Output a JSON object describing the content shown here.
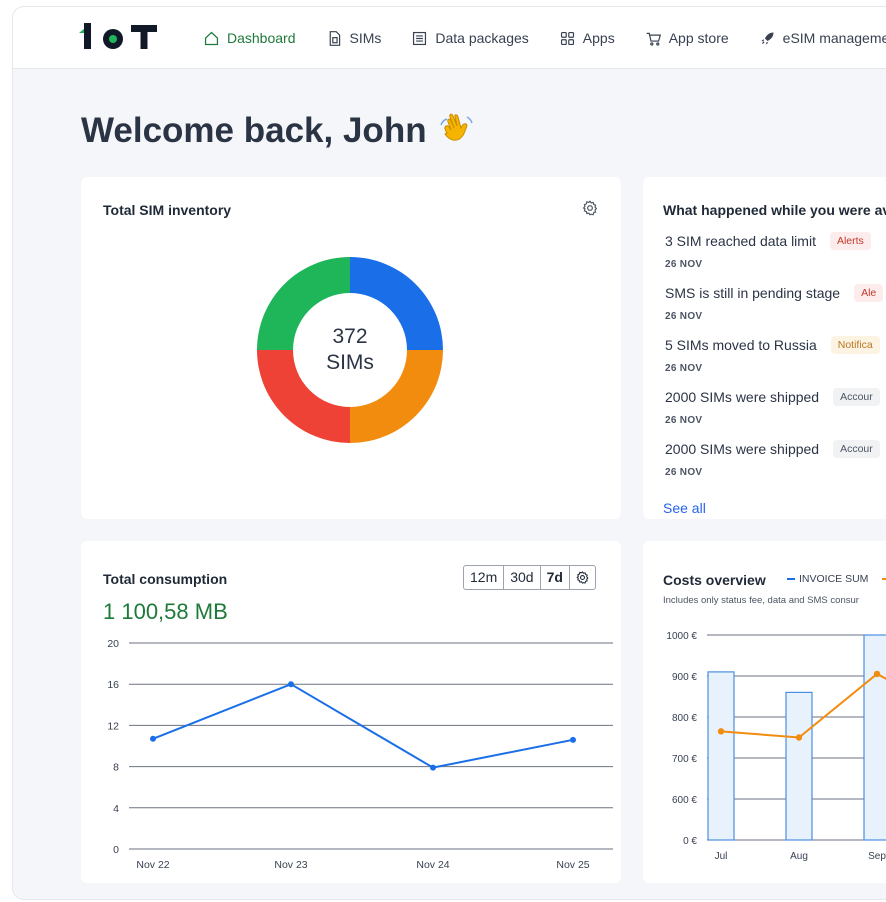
{
  "nav": {
    "items": [
      {
        "label": "Dashboard",
        "icon": "home-icon",
        "active": true
      },
      {
        "label": "SIMs",
        "icon": "sim-card-icon"
      },
      {
        "label": "Data packages",
        "icon": "package-icon"
      },
      {
        "label": "Apps",
        "icon": "apps-grid-icon"
      },
      {
        "label": "App store",
        "icon": "cart-icon"
      },
      {
        "label": "eSIM manageme",
        "icon": "rocket-icon"
      }
    ]
  },
  "welcome": {
    "title": "Welcome back, John"
  },
  "inventory": {
    "title": "Total SIM inventory",
    "count": "372",
    "unit": "SIMs",
    "colors": [
      "#1a6fe8",
      "#f28c0f",
      "#ee4237",
      "#1fb65a"
    ]
  },
  "events": {
    "title": "What happened while you were av",
    "items": [
      {
        "text": "3 SIM reached data limit",
        "tag": "Alerts",
        "tag_type": "alert",
        "date": "26 NOV"
      },
      {
        "text": "SMS is still in pending stage",
        "tag": "Ale",
        "tag_type": "alert",
        "date": "26 NOV"
      },
      {
        "text": "5 SIMs moved to Russia",
        "tag": "Notifica",
        "tag_type": "notif",
        "date": "26 NOV"
      },
      {
        "text": "2000 SIMs were shipped",
        "tag": "Accour",
        "tag_type": "acct",
        "date": "26 NOV"
      },
      {
        "text": "2000 SIMs were shipped",
        "tag": "Accour",
        "tag_type": "acct",
        "date": "26 NOV"
      }
    ],
    "see_all": "See all"
  },
  "consumption": {
    "title": "Total consumption",
    "value": "1 100,58 MB",
    "ranges": [
      "12m",
      "30d",
      "7d"
    ],
    "selected_range": "7d"
  },
  "costs": {
    "title": "Costs overview",
    "legend_invoice": "INVOICE SUM",
    "note": "Includes only status fee, data and SMS consur"
  },
  "chart_data": [
    {
      "type": "line",
      "title": "Total consumption",
      "categories": [
        "Nov 22",
        "Nov 23",
        "Nov 24",
        "Nov 25"
      ],
      "series": [
        {
          "values": [
            10.7,
            16,
            7.9,
            10.6
          ],
          "color": "#1a6fe8"
        }
      ],
      "yticks": [
        0,
        4,
        8,
        12,
        16,
        20
      ],
      "ylim": [
        0,
        20
      ],
      "grid": true
    },
    {
      "type": "bar",
      "title": "Costs overview",
      "categories": [
        "Jul",
        "Aug",
        "Sep"
      ],
      "yticks": [
        "0 €",
        "600 €",
        "700 €",
        "800 €",
        "900 €",
        "1000 €"
      ],
      "series": [
        {
          "name": "INVOICE SUM",
          "type": "bar",
          "values": [
            910,
            860,
            1000
          ],
          "color": "#1a6fe8"
        },
        {
          "type": "line",
          "values": [
            765,
            750,
            905
          ],
          "color": "#f28c0f"
        }
      ],
      "grid": true,
      "legend": "top"
    }
  ]
}
